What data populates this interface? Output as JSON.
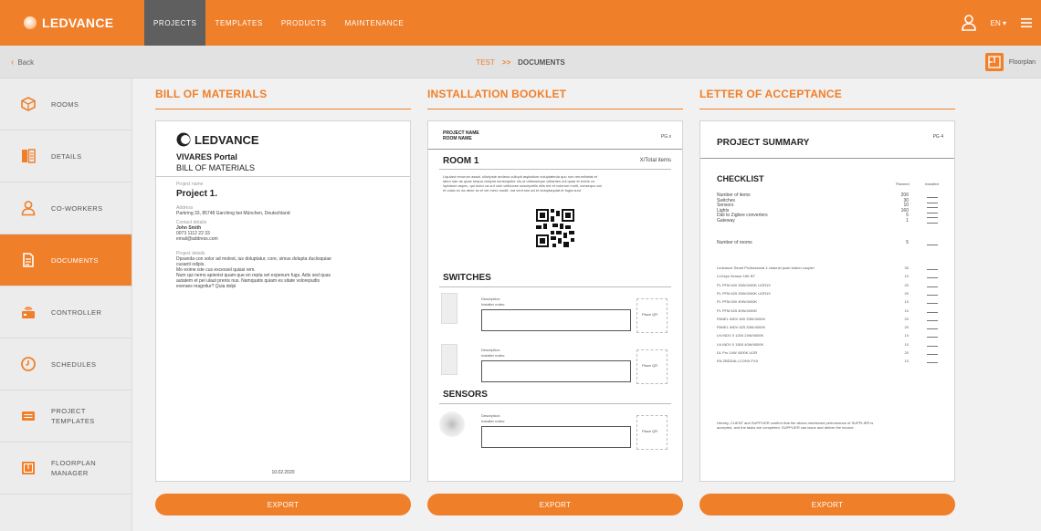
{
  "brand": {
    "name": "LEDVANCE",
    "accent": "#f07f2a",
    "nav_active": "#5f5f5f"
  },
  "nav": {
    "tabs": [
      {
        "label": "PROJECTS",
        "active": true
      },
      {
        "label": "TEMPLATES",
        "active": false
      },
      {
        "label": "PRODUCTS",
        "active": false
      },
      {
        "label": "MAINTENANCE",
        "active": false
      }
    ]
  },
  "header": {
    "language": "EN ▾",
    "user_icon": "user-icon",
    "menu_icon": "hamburger-icon"
  },
  "subbar": {
    "back": "Back",
    "crumb_project": "TEST",
    "crumb_sep": ">>",
    "crumb_page": "DOCUMENTS",
    "floorplan": "Floorplan"
  },
  "sidebar": {
    "items": [
      {
        "label": "ROOMS",
        "label2": "",
        "icon": "cube-icon",
        "active": false
      },
      {
        "label": "DETAILS",
        "label2": "",
        "icon": "details-icon",
        "active": false
      },
      {
        "label": "CO-WORKERS",
        "label2": "",
        "icon": "user-icon",
        "active": false
      },
      {
        "label": "DOCUMENTS",
        "label2": "",
        "icon": "document-icon",
        "active": true
      },
      {
        "label": "CONTROLLER",
        "label2": "",
        "icon": "controller-icon",
        "active": false
      },
      {
        "label": "SCHEDULES",
        "label2": "",
        "icon": "clock-icon",
        "active": false
      },
      {
        "label": "PROJECT",
        "label2": "TEMPLATES",
        "icon": "template-icon",
        "active": false
      },
      {
        "label": "FLOORPLAN",
        "label2": "MANAGER",
        "icon": "floorplan-icon",
        "active": false
      }
    ]
  },
  "bom": {
    "title": "BILL OF MATERIALS",
    "logo": "LEDVANCE",
    "portal": "VIVARES Portal",
    "doc_title": "BILL OF MATERIALS",
    "project_name_label": "Project name",
    "project_name": "Project 1.",
    "address_label": "Address",
    "address": "Parkring 33, 85748 Garching bei München, Deutschland",
    "contact_label": "Contact details",
    "contact_name": "John Smith",
    "contact_phone": "0073 1112 22 33",
    "contact_email": "email@address.com",
    "details_label": "Project details",
    "details_lines": [
      "Dpsanda con solor ad molest, ius doluptatur, core, simus dolupta duciisquiae",
      "cusanti odipis.",
      "Mo exime iste cus excessel quiasi rem.",
      "Num qui nemo apienist quam que en repta vel expenum fugs. Adis sed quas",
      "autatem et pel ulaut prenis nus. Namquatis quiam es sitate volorepudis",
      "everaes magnitur? Quia dolpi"
    ],
    "date": "10.02.2020",
    "export": "EXPORT"
  },
  "booklet": {
    "title": "INSTALLATION BOOKLET",
    "project_name": "PROJECT NAME",
    "room_name": "ROOM NAME",
    "page": "PG x",
    "room": "ROOM 1",
    "total": "X/Total items",
    "lorem": [
      "Liquiant renorum assat, ulloripste andeus cullupti asptatium voluptatenia quo non rerumlimtat et",
      "labor sae as quae sequa volupta nonsequibe nis ut obtesseque vellantes nul quas et ereris vo",
      "luptature aspec, qui dolor ca sut volo veliducse suscepetiis eliis ent et volorum molit, consequo sal",
      "et volac ex as dene se el vel mero modit, ma vent sim ad et doluptaquiat et fugia sunt"
    ],
    "switches": "SWITCHES",
    "sensors": "SENSORS",
    "description": "Description:",
    "installer_notes": "Installer notes:",
    "place_qr": "Place QR",
    "export": "EXPORT"
  },
  "letter": {
    "title": "LETTER OF ACCEPTANCE",
    "summary": "PROJECT SUMMARY",
    "page": "PG 4",
    "checklist": "CHECKLIST",
    "planned": "Planned",
    "installed": "Installed",
    "items": [
      {
        "name": "Number of items",
        "value": "206"
      },
      {
        "name": "Switches",
        "value": "30"
      },
      {
        "name": "Sensors",
        "value": "10"
      },
      {
        "name": "Lights",
        "value": "160"
      },
      {
        "name": "Dali to Zigbee converters",
        "value": "5"
      },
      {
        "name": "Gateway",
        "value": "1"
      }
    ],
    "rooms": {
      "name": "Number of rooms",
      "value": "5"
    },
    "products": [
      {
        "name": "Ledvance Smart Professional 4 channel push button coupler",
        "value": "30"
      },
      {
        "name": "LUXsys Sensor 16K BT",
        "value": "10"
      },
      {
        "name": "PL PFM 600 33W/4000K UGR19",
        "value": "20"
      },
      {
        "name": "PL PFM 625 33W/4000K UGR19",
        "value": "20"
      },
      {
        "name": "PL PFM 600 40W/4000K",
        "value": "10"
      },
      {
        "name": "PL PFM 625 40W/4000K",
        "value": "10"
      },
      {
        "name": "PANEL INDV 600 33W/4000K",
        "value": "20"
      },
      {
        "name": "PANEL INDV 625 33W/4000K",
        "value": "20"
      },
      {
        "name": "LN INDV 0 1200 24W/4000K",
        "value": "10"
      },
      {
        "name": "LN INDV 0 1500 40W/4000K",
        "value": "10"
      },
      {
        "name": "DL Pro 14W 4000K UGR",
        "value": "20"
      },
      {
        "name": "EN ZBDDALI-CONV-FXII",
        "value": "10"
      }
    ],
    "footer_lines": [
      "Hereby, CLIENT and SUPPLIER confirm that the above-mentioned performance of SUPPLIER is",
      "accepted, and the tasks are completed. SUPPLIER can issue and deliver the invoice."
    ],
    "export": "EXPORT"
  }
}
